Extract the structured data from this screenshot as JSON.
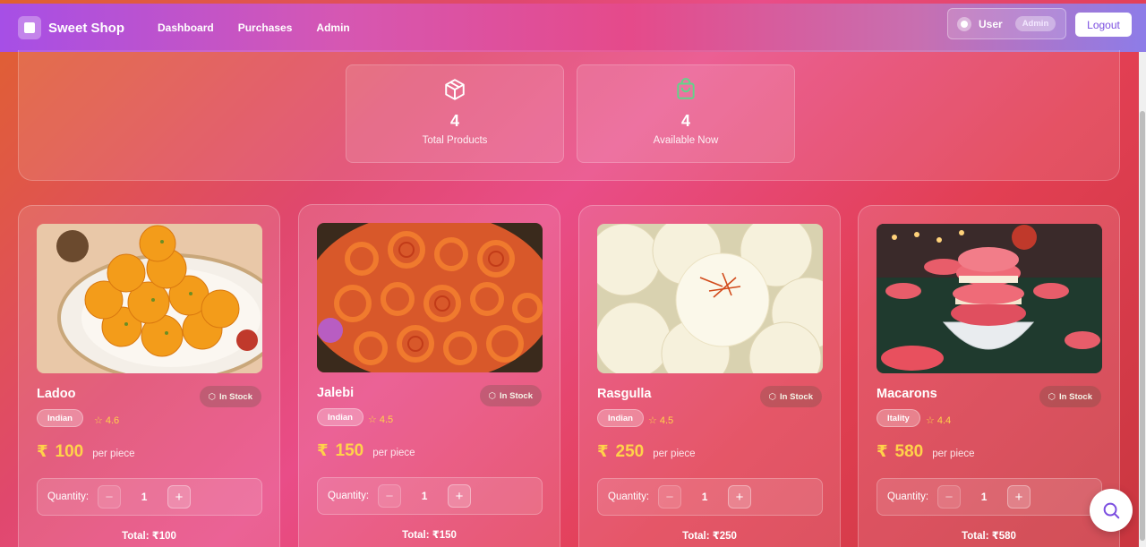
{
  "header": {
    "brand": "Sweet Shop",
    "nav": [
      "Dashboard",
      "Purchases",
      "Admin"
    ],
    "user_name": "User",
    "role": "Admin",
    "logout": "Logout"
  },
  "stats": [
    {
      "value": "4",
      "label": "Total Products",
      "icon": "package-icon"
    },
    {
      "value": "4",
      "label": "Available Now",
      "icon": "shopping-bag-icon"
    }
  ],
  "products": [
    {
      "name": "Ladoo",
      "category": "Indian",
      "rating": "4.6",
      "currency": "₹",
      "price": "100",
      "unit": "per piece",
      "stock": "In Stock",
      "qty_label": "Quantity:",
      "qty": "1",
      "total": "Total: ₹100"
    },
    {
      "name": "Jalebi",
      "category": "Indian",
      "rating": "4.5",
      "currency": "₹",
      "price": "150",
      "unit": "per piece",
      "stock": "In Stock",
      "qty_label": "Quantity:",
      "qty": "1",
      "total": "Total: ₹150"
    },
    {
      "name": "Rasgulla",
      "category": "Indian",
      "rating": "4.5",
      "currency": "₹",
      "price": "250",
      "unit": "per piece",
      "stock": "In Stock",
      "qty_label": "Quantity:",
      "qty": "1",
      "total": "Total: ₹250"
    },
    {
      "name": "Macarons",
      "category": "Itality",
      "rating": "4.4",
      "currency": "₹",
      "price": "580",
      "unit": "per piece",
      "stock": "In Stock",
      "qty_label": "Quantity:",
      "qty": "1",
      "total": "Total: ₹580"
    }
  ],
  "colors": {
    "accent": "#7b4ee0",
    "price": "#ffd24a"
  }
}
